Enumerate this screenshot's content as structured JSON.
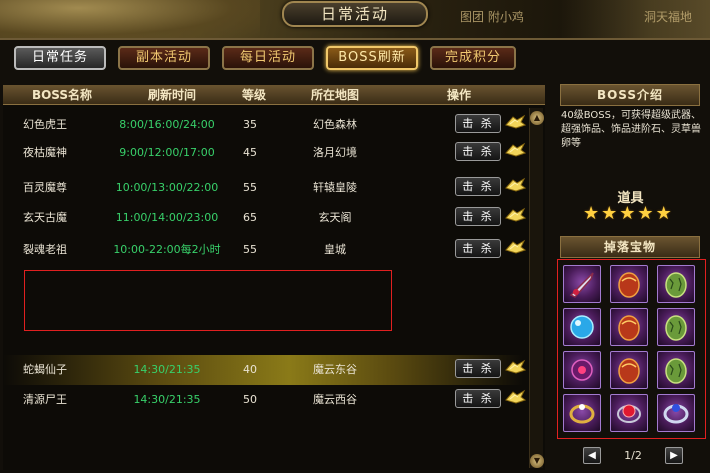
{
  "window": {
    "title": "日常活动"
  },
  "background_text": {
    "left": "图团 附小鸡",
    "right": "洞天福地"
  },
  "tabs": [
    {
      "label": "日常任务"
    },
    {
      "label": "副本活动"
    },
    {
      "label": "每日活动"
    },
    {
      "label": "BOSS刷新"
    },
    {
      "label": "完成积分"
    }
  ],
  "active_tab": "BOSS刷新",
  "table": {
    "headers": {
      "name": "BOSS名称",
      "time": "刷新时间",
      "level": "等级",
      "map": "所在地图",
      "action": "操作"
    },
    "kill_label": "击 杀",
    "rows": [
      {
        "name": "幻色虎王",
        "time": "8:00/16:00/24:00",
        "level": "35",
        "map": "幻色森林"
      },
      {
        "name": "夜枯魔神",
        "time": "9:00/12:00/17:00",
        "level": "45",
        "map": "洛月幻境"
      },
      {
        "name": "百灵魔尊",
        "time": "10:00/13:00/22:00",
        "level": "55",
        "map": "轩辕皇陵"
      },
      {
        "name": "玄天古魔",
        "time": "11:00/14:00/23:00",
        "level": "65",
        "map": "玄天阁"
      },
      {
        "name": "裂魂老祖",
        "time": "10:00-22:00每2小时",
        "level": "55",
        "map": "皇城"
      },
      {
        "name": "蛇蝎仙子",
        "time": "14:30/21:35",
        "level": "40",
        "map": "魔云东谷"
      },
      {
        "name": "清源尸王",
        "time": "14:30/21:35",
        "level": "50",
        "map": "魔云西谷"
      }
    ]
  },
  "boss_intro": {
    "title": "BOSS介绍",
    "description": "40级BOSS，可获得超级武器、超强饰品、饰品进阶石、灵草兽卵等"
  },
  "props": {
    "label": "道具",
    "star_count": 5,
    "star_glyph": "★"
  },
  "drops": {
    "title": "掉落宝物",
    "items": [
      {
        "icon": "sword-icon"
      },
      {
        "icon": "red-egg-icon"
      },
      {
        "icon": "green-egg-icon"
      },
      {
        "icon": "blue-orb-icon"
      },
      {
        "icon": "red-egg-icon"
      },
      {
        "icon": "green-egg-icon"
      },
      {
        "icon": "gem-flower-icon"
      },
      {
        "icon": "red-egg-icon"
      },
      {
        "icon": "green-egg-icon"
      },
      {
        "icon": "gold-ring-icon"
      },
      {
        "icon": "ruby-icon"
      },
      {
        "icon": "silver-ring-icon"
      }
    ]
  },
  "pager": {
    "text": "1/2",
    "prev": "◀",
    "next": "▶"
  },
  "scroll": {
    "up": "▲",
    "down": "▼"
  }
}
